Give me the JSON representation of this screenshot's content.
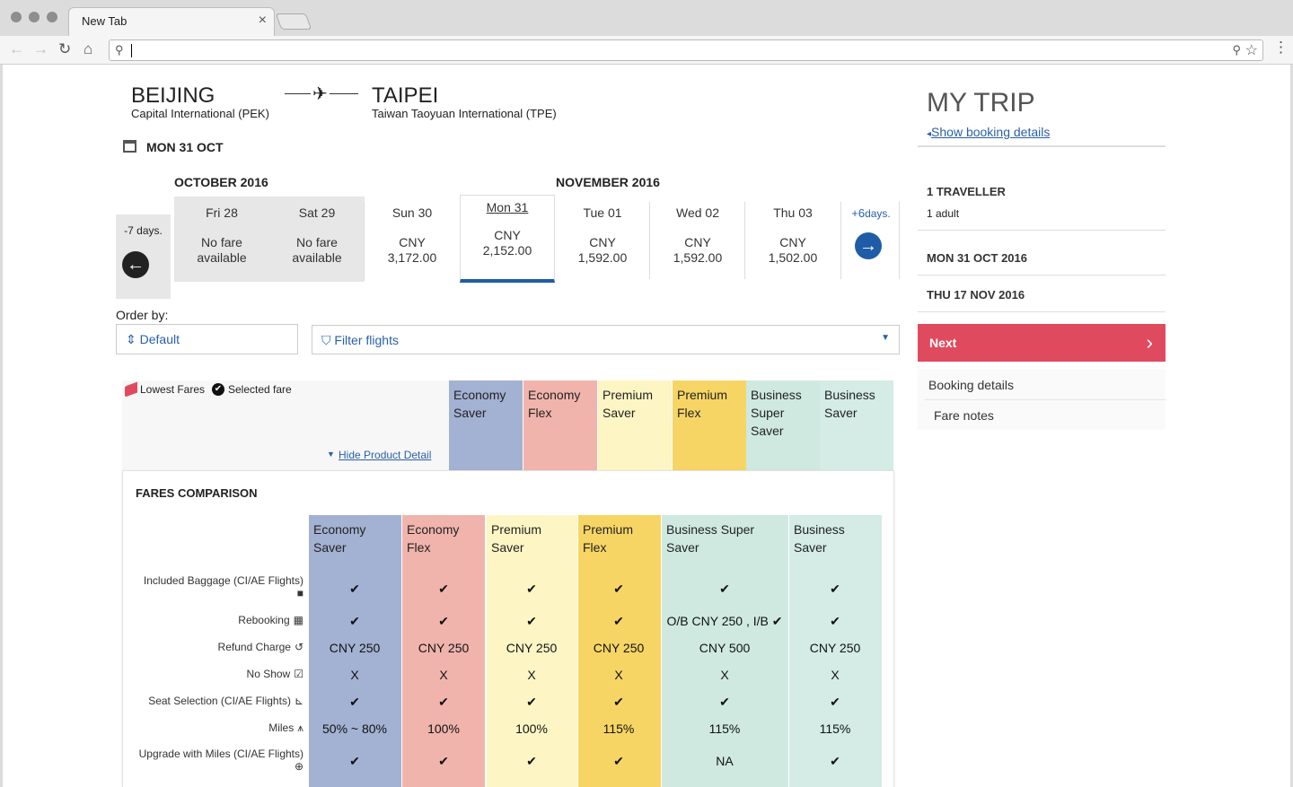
{
  "browser": {
    "tab_title": "New Tab",
    "tab_close": "×",
    "address": ""
  },
  "route": {
    "from_city": "BEIJING",
    "from_airport": "Capital International (PEK)",
    "to_city": "TAIPEI",
    "to_airport": "Taiwan Taoyuan International (TPE)",
    "arrow": "✈"
  },
  "selected_date": "MON 31 OCT",
  "months": {
    "october": "OCTOBER 2016",
    "november": "NOVEMBER 2016"
  },
  "day_nav": {
    "prev_label": "-7 days.",
    "next_label": "+6",
    "next_suffix": "days."
  },
  "days": [
    {
      "name": "Fri 28",
      "l1": "No fare",
      "l2": "available"
    },
    {
      "name": "Sat 29",
      "l1": "No fare",
      "l2": "available"
    },
    {
      "name": "Sun 30",
      "l1": "CNY",
      "l2": "3,172.00"
    },
    {
      "name": "Mon 31",
      "l1": "CNY",
      "l2": "2,152.00"
    },
    {
      "name": "Tue 01",
      "l1": "CNY",
      "l2": "1,592.00"
    },
    {
      "name": "Wed 02",
      "l1": "CNY",
      "l2": "1,592.00"
    },
    {
      "name": "Thu 03",
      "l1": "CNY",
      "l2": "1,502.00"
    }
  ],
  "order": {
    "label": "Order by:",
    "value": "Default"
  },
  "filter": {
    "label": "Filter flights"
  },
  "legend": {
    "lowest": "Lowest Fares",
    "selected": "Selected fare",
    "hide_detail": "Hide Product Detail"
  },
  "products": [
    {
      "l1": "Economy",
      "l2": "Saver",
      "l3": ""
    },
    {
      "l1": "Economy",
      "l2": "Flex",
      "l3": ""
    },
    {
      "l1": "Premium",
      "l2": "Saver",
      "l3": ""
    },
    {
      "l1": "Premium",
      "l2": "Flex",
      "l3": ""
    },
    {
      "l1": "Business",
      "l2": "Super",
      "l3": "Saver"
    },
    {
      "l1": "Business",
      "l2": "Saver",
      "l3": ""
    }
  ],
  "comparison": {
    "title": "FARES COMPARISON",
    "headers": [
      {
        "l1": "Economy",
        "l2": "Saver"
      },
      {
        "l1": "Economy",
        "l2": "Flex"
      },
      {
        "l1": "Premium",
        "l2": "Saver"
      },
      {
        "l1": "Premium",
        "l2": "Flex"
      },
      {
        "l1": "Business Super",
        "l2": "Saver"
      },
      {
        "l1": "Business",
        "l2": "Saver"
      }
    ],
    "rows": [
      {
        "label": "Included Baggage (CI/AE Flights)",
        "icon": "■",
        "cells": [
          "✔",
          "✔",
          "✔",
          "✔",
          "✔",
          "✔"
        ]
      },
      {
        "label": "Rebooking",
        "icon": "▦",
        "cells": [
          "✔",
          "✔",
          "✔",
          "✔",
          "O/B CNY 250 , I/B ✔",
          "✔"
        ]
      },
      {
        "label": "Refund Charge",
        "icon": "↺",
        "cells": [
          "CNY 250",
          "CNY 250",
          "CNY 250",
          "CNY 250",
          "CNY 500",
          "CNY 250"
        ]
      },
      {
        "label": "No Show",
        "icon": "☑",
        "cells": [
          "X",
          "X",
          "X",
          "X",
          "X",
          "X"
        ]
      },
      {
        "label": "Seat Selection (CI/AE Flights)",
        "icon": "⊾",
        "cells": [
          "✔",
          "✔",
          "✔",
          "✔",
          "✔",
          "✔"
        ]
      },
      {
        "label": "Miles",
        "icon": "⩚",
        "cells": [
          "50% ~ 80%",
          "100%",
          "100%",
          "115%",
          "115%",
          "115%"
        ]
      },
      {
        "label": "Upgrade with Miles (CI/AE Flights)",
        "icon": "⊕",
        "cells": [
          "✔",
          "✔",
          "✔",
          "✔",
          "NA",
          "✔"
        ]
      }
    ]
  },
  "trip": {
    "title": "MY TRIP",
    "show_details": "Show booking details",
    "traveller": "1 TRAVELLER",
    "adults": "1 adult",
    "date_out": "MON 31 OCT 2016",
    "date_back": "THU 17 NOV 2016",
    "next": "Next",
    "links": [
      "Booking details",
      "Fare notes"
    ]
  },
  "colors": {
    "accent": "#e04a5f",
    "blue": "#2a5fa8"
  }
}
